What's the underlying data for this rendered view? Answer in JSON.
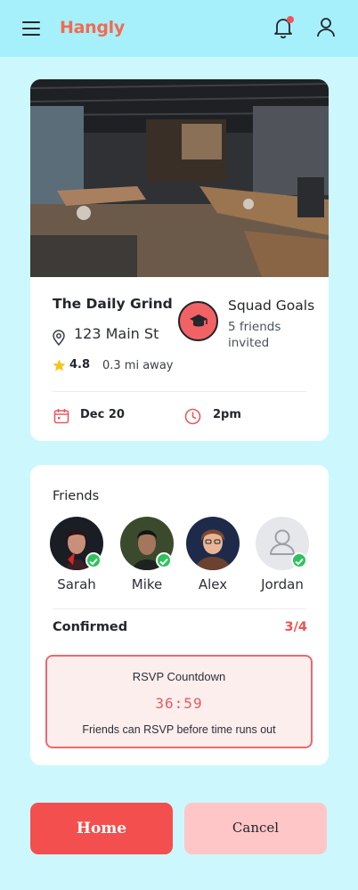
{
  "app": {
    "name": "Hangly"
  },
  "header": {
    "menu_icon": "hamburger-menu-icon",
    "bell_icon": "bell-icon",
    "profile_icon": "user-icon",
    "has_notification": true
  },
  "venue": {
    "name": "The Daily Grind",
    "address": "123 Main St",
    "rating": "4.8",
    "distance": "0.3 mi away",
    "photo": "cafe-interior-photo"
  },
  "group": {
    "name": "Squad Goals",
    "subtitle": "5 friends invited",
    "icon": "graduation-cap-icon"
  },
  "event": {
    "date": "Dec 20",
    "time": "2pm"
  },
  "friends": {
    "title": "Friends",
    "list": [
      {
        "name": "Sarah",
        "confirmed": true
      },
      {
        "name": "Mike",
        "confirmed": true
      },
      {
        "name": "Alex",
        "confirmed": true
      },
      {
        "name": "Jordan",
        "confirmed": true
      }
    ]
  },
  "confirmed": {
    "label": "Confirmed",
    "count": "3/4"
  },
  "rsvp": {
    "title": "RSVP Countdown",
    "timer": "36:59",
    "note": "Friends can RSVP before time runs out"
  },
  "actions": {
    "home": "Home",
    "cancel": "Cancel"
  },
  "colors": {
    "accent": "#f34f4f",
    "brand": "#f26b50",
    "background": "#ccf8fd",
    "header": "#a6f0fb",
    "success": "#2fc15d"
  }
}
